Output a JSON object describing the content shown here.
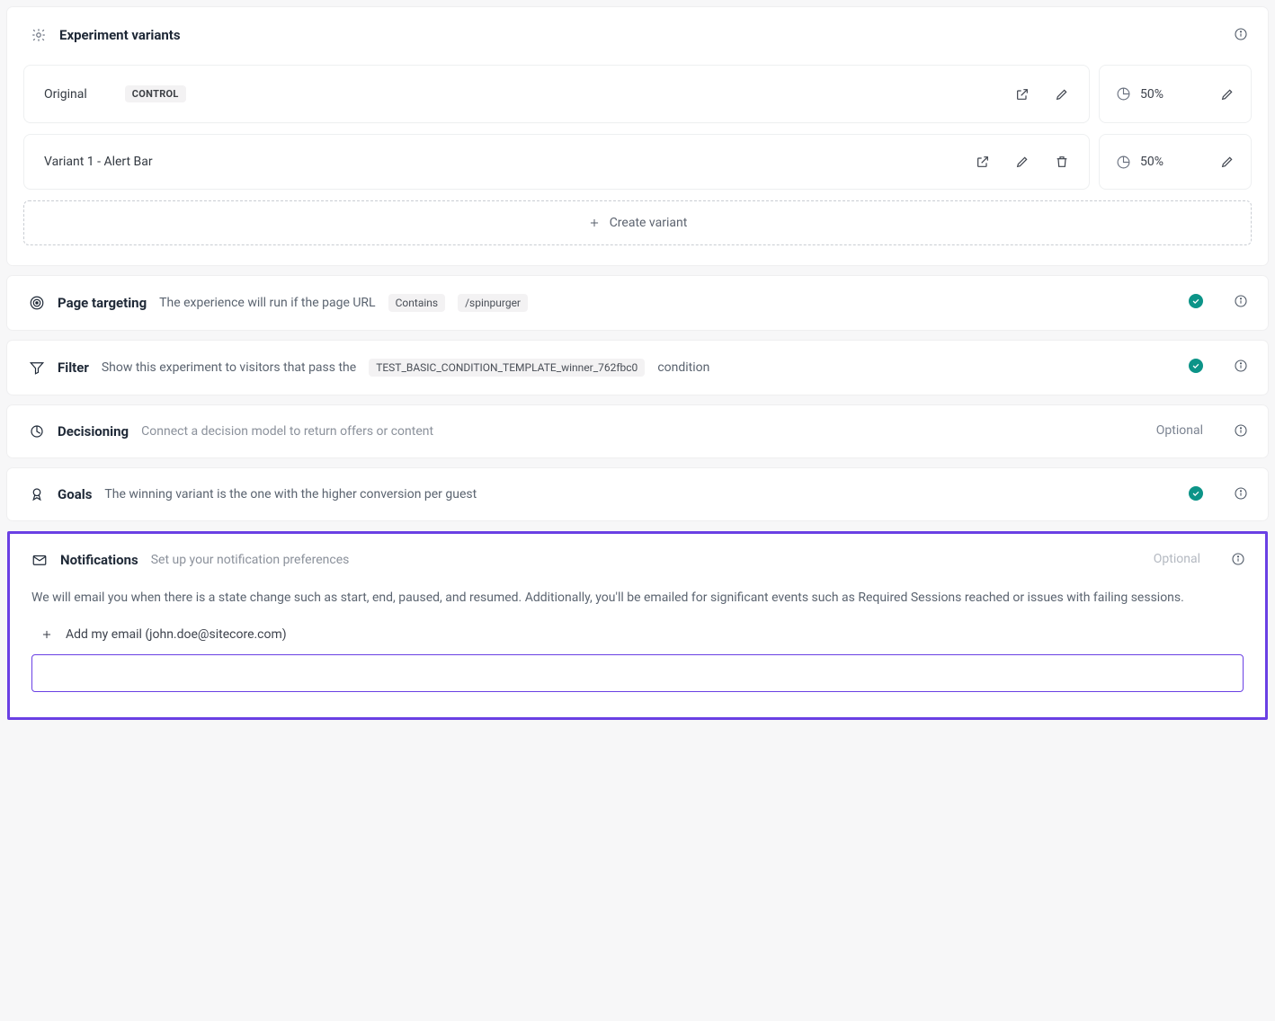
{
  "variants": {
    "title": "Experiment variants",
    "items": [
      {
        "name": "Original",
        "badge": "CONTROL",
        "allocation": "50%",
        "deletable": false
      },
      {
        "name": "Variant 1 - Alert Bar",
        "badge": null,
        "allocation": "50%",
        "deletable": true
      }
    ],
    "create_label": "Create variant"
  },
  "page_targeting": {
    "title": "Page targeting",
    "lead": "The experience will run if the page URL",
    "operator": "Contains",
    "value": "/spinpurger"
  },
  "filter": {
    "title": "Filter",
    "lead": "Show this experiment to visitors that pass the",
    "template": "TEST_BASIC_CONDITION_TEMPLATE_winner_762fbc0",
    "trail": "condition"
  },
  "decisioning": {
    "title": "Decisioning",
    "sub": "Connect a decision model to return offers or content",
    "optional": "Optional"
  },
  "goals": {
    "title": "Goals",
    "sub": "The winning variant is the one with the higher conversion per guest"
  },
  "notifications": {
    "title": "Notifications",
    "sub": "Set up your notification preferences",
    "optional": "Optional",
    "desc": "We will email you when there is a state change such as start, end, paused, and resumed. Additionally, you'll be emailed for significant events such as Required Sessions reached or issues with failing sessions.",
    "add_email_label": "Add my email (john.doe@sitecore.com)"
  }
}
